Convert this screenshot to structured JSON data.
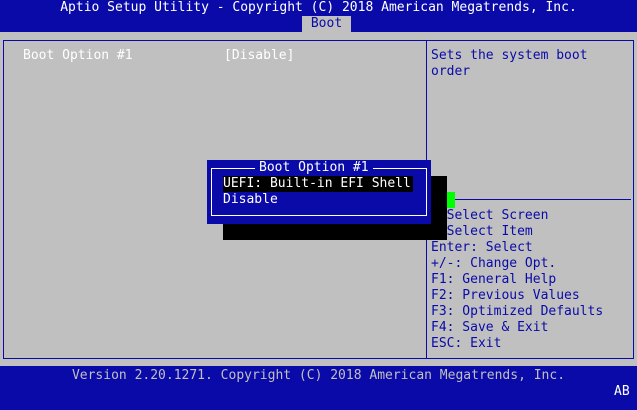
{
  "header": {
    "title": "Aptio Setup Utility - Copyright (C) 2018 American Megatrends, Inc.",
    "tabs": [
      {
        "label": "Boot",
        "active": true
      }
    ]
  },
  "main": {
    "options": [
      {
        "label": "Boot Option #1",
        "value": "[Disable]"
      }
    ]
  },
  "help": {
    "text": "Sets the system boot\norder",
    "keys": [
      ": Select Screen",
      ": Select Item",
      "Enter: Select",
      "+/-: Change Opt.",
      "F1: General Help",
      "F2: Previous Values",
      "F3: Optimized Defaults",
      "F4: Save & Exit",
      "ESC: Exit"
    ]
  },
  "popup": {
    "title": "Boot Option #1",
    "items": [
      {
        "label": "UEFI: Built-in EFI Shell",
        "selected": true
      },
      {
        "label": "Disable",
        "selected": false
      }
    ]
  },
  "footer": {
    "version": "Version 2.20.1271. Copyright (C) 2018 American Megatrends, Inc.",
    "code": "AB"
  },
  "colors": {
    "background": "#c0c0c0",
    "bar_blue": "#0a0aa8",
    "text_white": "#ffffff",
    "cursor_green": "#00ff00",
    "selection_black": "#000000"
  }
}
